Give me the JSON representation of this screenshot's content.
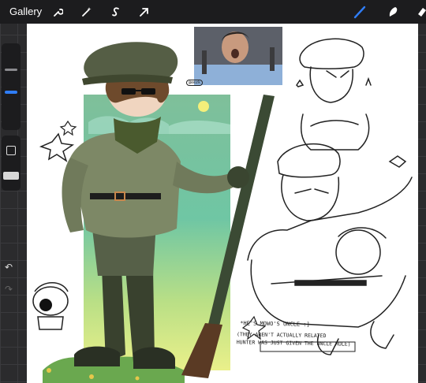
{
  "app": {
    "gallery_label": "Gallery"
  },
  "toolbar": {
    "left_tools": [
      "wrench-icon",
      "magic-wand-icon",
      "selection-icon",
      "transform-arrow-icon"
    ],
    "right_tools": [
      "brush-icon",
      "smudge-icon",
      "eraser-icon"
    ],
    "active_tool": "brush-icon",
    "accent_color": "#2f7df6"
  },
  "sidebar": {
    "brush_size_slider": "brush-size",
    "opacity_slider": "opacity",
    "modify_button": "square-icon",
    "undo_icon": "undo-icon",
    "redo_icon": "redo-icon"
  },
  "canvas": {
    "signature_text": "@eezk",
    "caption_line1": "*HE'S MOWO'S UNCLE :]",
    "caption_line2": "(THEY AREN'T ACTUALLY RELATED",
    "caption_line3": "HUNTER WAS JUST GIVEN THE UNCLE ROLE)"
  }
}
